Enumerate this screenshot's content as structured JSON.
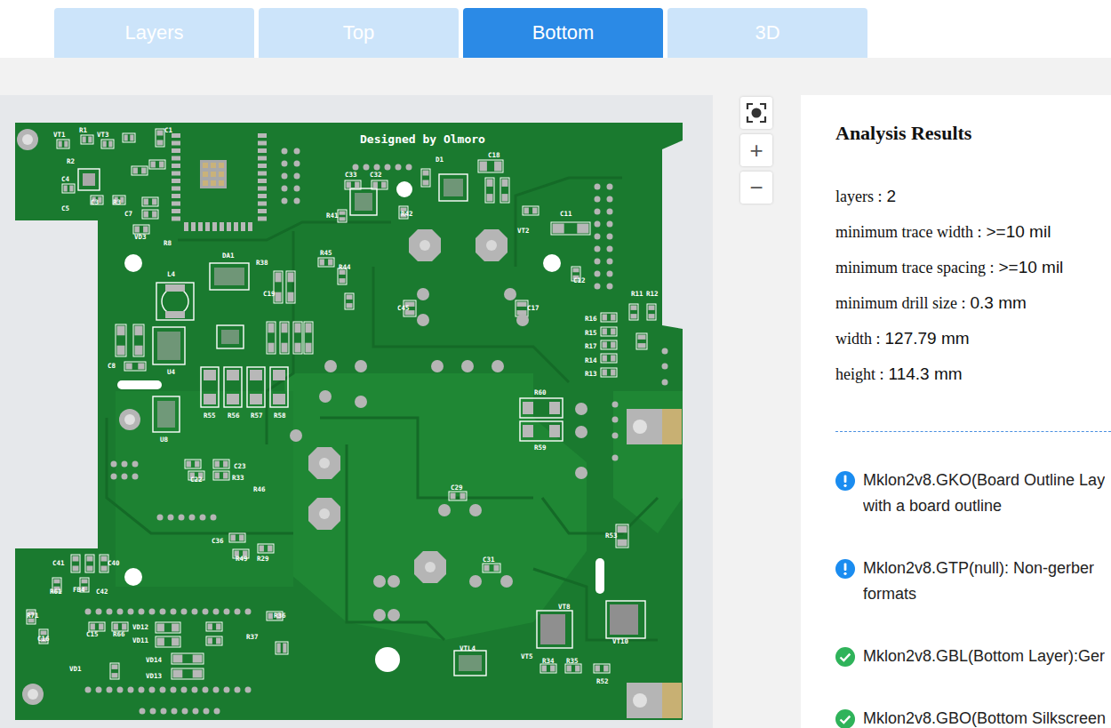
{
  "tabs": [
    {
      "label": "Layers",
      "selected": false
    },
    {
      "label": "Top",
      "selected": false
    },
    {
      "label": "Bottom",
      "selected": true
    },
    {
      "label": "3D",
      "selected": false
    }
  ],
  "zoom": {
    "in": "+",
    "out": "−"
  },
  "board": {
    "credit": "Designed by Olmoro",
    "labels": [
      "VT1",
      "R1",
      "VT3",
      "C1",
      "R2",
      "C4",
      "C5",
      "C3",
      "R3",
      "C7",
      "VD3",
      "R8",
      "DA1",
      "R38",
      "L4",
      "C8",
      "U4",
      "R55",
      "R56",
      "R57",
      "R58",
      "U8",
      "C22",
      "C23",
      "R33",
      "R46",
      "C36",
      "R49",
      "R29",
      "C41",
      "C40",
      "R61",
      "FB4",
      "C42",
      "R71",
      "C16",
      "C15",
      "R66",
      "VD12",
      "VD11",
      "VD14",
      "VD13",
      "VD1",
      "R36",
      "R37",
      "C33",
      "C32",
      "D1",
      "C18",
      "R41",
      "R42",
      "VT2",
      "C11",
      "C12",
      "R11",
      "R12",
      "R16",
      "R15",
      "R17",
      "R14",
      "R13",
      "C17",
      "R60",
      "R59",
      "C29",
      "C31",
      "R53",
      "VT8",
      "VT10",
      "VTL4",
      "VT5",
      "R34",
      "R35",
      "R52",
      "R45",
      "R44",
      "C19",
      "C45"
    ]
  },
  "analysis": {
    "title": "Analysis Results",
    "specs": [
      {
        "label": "layers :",
        "value": "2"
      },
      {
        "label": "minimum trace width :",
        "value": ">=10 mil"
      },
      {
        "label": "minimum trace spacing :",
        "value": ">=10 mil"
      },
      {
        "label": "minimum drill size :",
        "value": "0.3 mm"
      },
      {
        "label": "width :",
        "value": "127.79 mm"
      },
      {
        "label": "height :",
        "value": "114.3 mm"
      }
    ],
    "files": [
      {
        "kind": "info",
        "lines": [
          "Mklon2v8.GKO(Board Outline Lay",
          "with a board outline"
        ]
      },
      {
        "kind": "info",
        "lines": [
          "Mklon2v8.GTP(null): Non-gerber",
          "formats"
        ]
      },
      {
        "kind": "ok",
        "lines": [
          "Mklon2v8.GBL(Bottom Layer):Ger"
        ]
      },
      {
        "kind": "ok",
        "lines": [
          "Mklon2v8.GBO(Bottom Silkscreen"
        ]
      }
    ]
  }
}
